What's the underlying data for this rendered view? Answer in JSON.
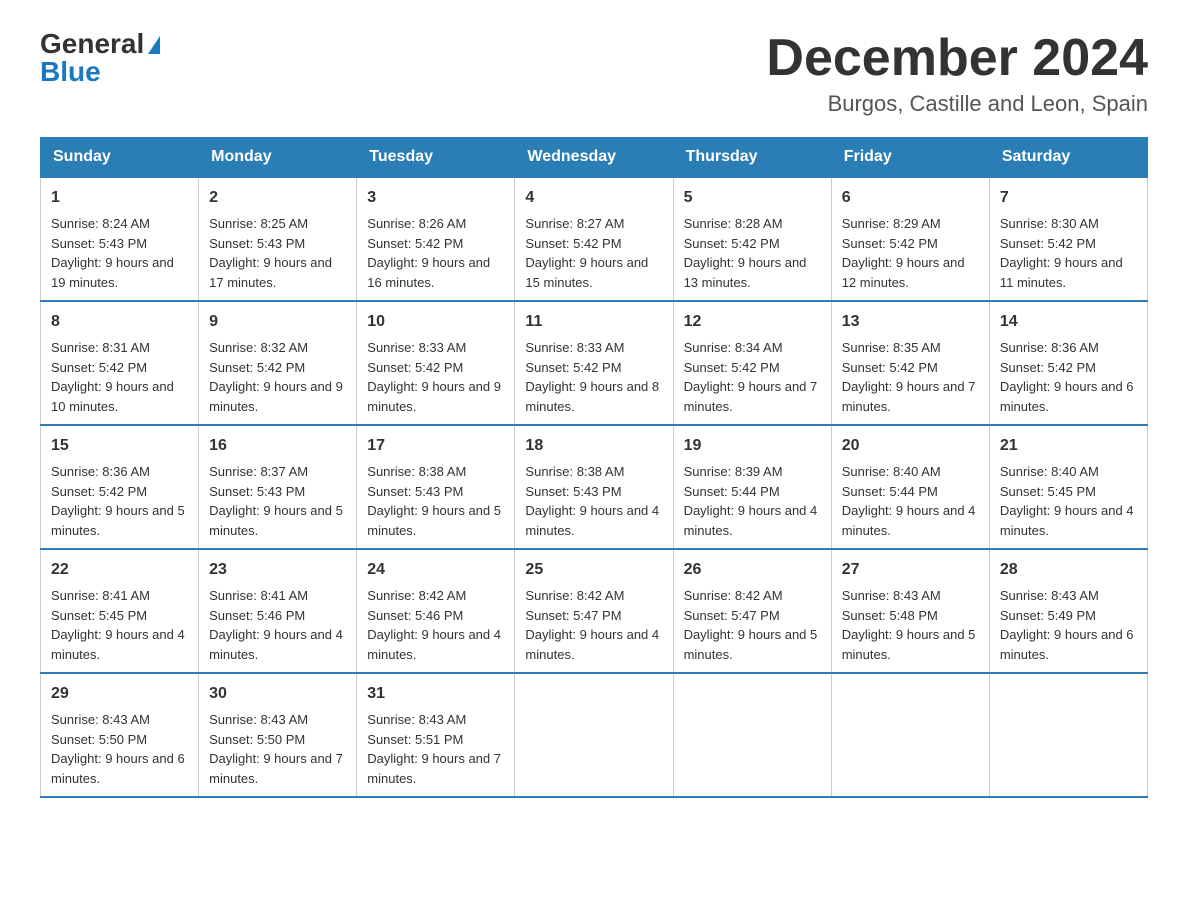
{
  "header": {
    "logo_general": "General",
    "logo_blue": "Blue",
    "month_title": "December 2024",
    "location": "Burgos, Castille and Leon, Spain"
  },
  "days_of_week": [
    "Sunday",
    "Monday",
    "Tuesday",
    "Wednesday",
    "Thursday",
    "Friday",
    "Saturday"
  ],
  "weeks": [
    [
      {
        "day": "1",
        "sunrise": "8:24 AM",
        "sunset": "5:43 PM",
        "daylight": "9 hours and 19 minutes."
      },
      {
        "day": "2",
        "sunrise": "8:25 AM",
        "sunset": "5:43 PM",
        "daylight": "9 hours and 17 minutes."
      },
      {
        "day": "3",
        "sunrise": "8:26 AM",
        "sunset": "5:42 PM",
        "daylight": "9 hours and 16 minutes."
      },
      {
        "day": "4",
        "sunrise": "8:27 AM",
        "sunset": "5:42 PM",
        "daylight": "9 hours and 15 minutes."
      },
      {
        "day": "5",
        "sunrise": "8:28 AM",
        "sunset": "5:42 PM",
        "daylight": "9 hours and 13 minutes."
      },
      {
        "day": "6",
        "sunrise": "8:29 AM",
        "sunset": "5:42 PM",
        "daylight": "9 hours and 12 minutes."
      },
      {
        "day": "7",
        "sunrise": "8:30 AM",
        "sunset": "5:42 PM",
        "daylight": "9 hours and 11 minutes."
      }
    ],
    [
      {
        "day": "8",
        "sunrise": "8:31 AM",
        "sunset": "5:42 PM",
        "daylight": "9 hours and 10 minutes."
      },
      {
        "day": "9",
        "sunrise": "8:32 AM",
        "sunset": "5:42 PM",
        "daylight": "9 hours and 9 minutes."
      },
      {
        "day": "10",
        "sunrise": "8:33 AM",
        "sunset": "5:42 PM",
        "daylight": "9 hours and 9 minutes."
      },
      {
        "day": "11",
        "sunrise": "8:33 AM",
        "sunset": "5:42 PM",
        "daylight": "9 hours and 8 minutes."
      },
      {
        "day": "12",
        "sunrise": "8:34 AM",
        "sunset": "5:42 PM",
        "daylight": "9 hours and 7 minutes."
      },
      {
        "day": "13",
        "sunrise": "8:35 AM",
        "sunset": "5:42 PM",
        "daylight": "9 hours and 7 minutes."
      },
      {
        "day": "14",
        "sunrise": "8:36 AM",
        "sunset": "5:42 PM",
        "daylight": "9 hours and 6 minutes."
      }
    ],
    [
      {
        "day": "15",
        "sunrise": "8:36 AM",
        "sunset": "5:42 PM",
        "daylight": "9 hours and 5 minutes."
      },
      {
        "day": "16",
        "sunrise": "8:37 AM",
        "sunset": "5:43 PM",
        "daylight": "9 hours and 5 minutes."
      },
      {
        "day": "17",
        "sunrise": "8:38 AM",
        "sunset": "5:43 PM",
        "daylight": "9 hours and 5 minutes."
      },
      {
        "day": "18",
        "sunrise": "8:38 AM",
        "sunset": "5:43 PM",
        "daylight": "9 hours and 4 minutes."
      },
      {
        "day": "19",
        "sunrise": "8:39 AM",
        "sunset": "5:44 PM",
        "daylight": "9 hours and 4 minutes."
      },
      {
        "day": "20",
        "sunrise": "8:40 AM",
        "sunset": "5:44 PM",
        "daylight": "9 hours and 4 minutes."
      },
      {
        "day": "21",
        "sunrise": "8:40 AM",
        "sunset": "5:45 PM",
        "daylight": "9 hours and 4 minutes."
      }
    ],
    [
      {
        "day": "22",
        "sunrise": "8:41 AM",
        "sunset": "5:45 PM",
        "daylight": "9 hours and 4 minutes."
      },
      {
        "day": "23",
        "sunrise": "8:41 AM",
        "sunset": "5:46 PM",
        "daylight": "9 hours and 4 minutes."
      },
      {
        "day": "24",
        "sunrise": "8:42 AM",
        "sunset": "5:46 PM",
        "daylight": "9 hours and 4 minutes."
      },
      {
        "day": "25",
        "sunrise": "8:42 AM",
        "sunset": "5:47 PM",
        "daylight": "9 hours and 4 minutes."
      },
      {
        "day": "26",
        "sunrise": "8:42 AM",
        "sunset": "5:47 PM",
        "daylight": "9 hours and 5 minutes."
      },
      {
        "day": "27",
        "sunrise": "8:43 AM",
        "sunset": "5:48 PM",
        "daylight": "9 hours and 5 minutes."
      },
      {
        "day": "28",
        "sunrise": "8:43 AM",
        "sunset": "5:49 PM",
        "daylight": "9 hours and 6 minutes."
      }
    ],
    [
      {
        "day": "29",
        "sunrise": "8:43 AM",
        "sunset": "5:50 PM",
        "daylight": "9 hours and 6 minutes."
      },
      {
        "day": "30",
        "sunrise": "8:43 AM",
        "sunset": "5:50 PM",
        "daylight": "9 hours and 7 minutes."
      },
      {
        "day": "31",
        "sunrise": "8:43 AM",
        "sunset": "5:51 PM",
        "daylight": "9 hours and 7 minutes."
      },
      null,
      null,
      null,
      null
    ]
  ]
}
